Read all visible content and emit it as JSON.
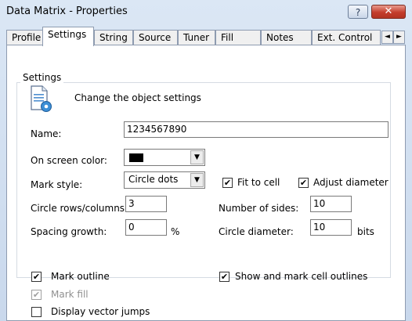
{
  "window": {
    "title": "Data Matrix - Properties",
    "help_label": "?",
    "close_label": "✕"
  },
  "tabs": [
    {
      "label": "Profile"
    },
    {
      "label": "Settings"
    },
    {
      "label": "String"
    },
    {
      "label": "Source"
    },
    {
      "label": "Tuner"
    },
    {
      "label": "Fill"
    },
    {
      "label": "Notes"
    },
    {
      "label": "Ext. Control"
    }
  ],
  "active_tab": "Settings",
  "scroll": {
    "left": "◄",
    "right": "►"
  },
  "group": {
    "label": "Settings",
    "description": "Change the object settings",
    "icon": "settings-document-icon"
  },
  "fields": {
    "name": {
      "label": "Name:",
      "value": "1234567890"
    },
    "on_screen_color": {
      "label": "On screen color:",
      "value": "#000000"
    },
    "mark_style": {
      "label": "Mark style:",
      "value": "Circle dots"
    },
    "circle_rows_columns": {
      "label": "Circle rows/columns:",
      "value": "3"
    },
    "spacing_growth": {
      "label": "Spacing growth:",
      "value": "0",
      "unit": "%"
    },
    "number_of_sides": {
      "label": "Number of sides:",
      "value": "10"
    },
    "circle_diameter": {
      "label": "Circle diameter:",
      "value": "10",
      "unit": "bits"
    }
  },
  "checks": {
    "fit_to_cell": {
      "label": "Fit to cell",
      "checked": true
    },
    "adjust_diameter": {
      "label": "Adjust diameter",
      "checked": true
    },
    "mark_outline": {
      "label": "Mark outline",
      "checked": true
    },
    "show_mark_cell_outlines": {
      "label": "Show and mark cell outlines",
      "checked": true
    },
    "mark_fill": {
      "label": "Mark fill",
      "checked": true,
      "disabled": true
    },
    "display_vector_jumps": {
      "label": "Display vector jumps",
      "checked": false
    }
  },
  "check_glyph": "✔"
}
